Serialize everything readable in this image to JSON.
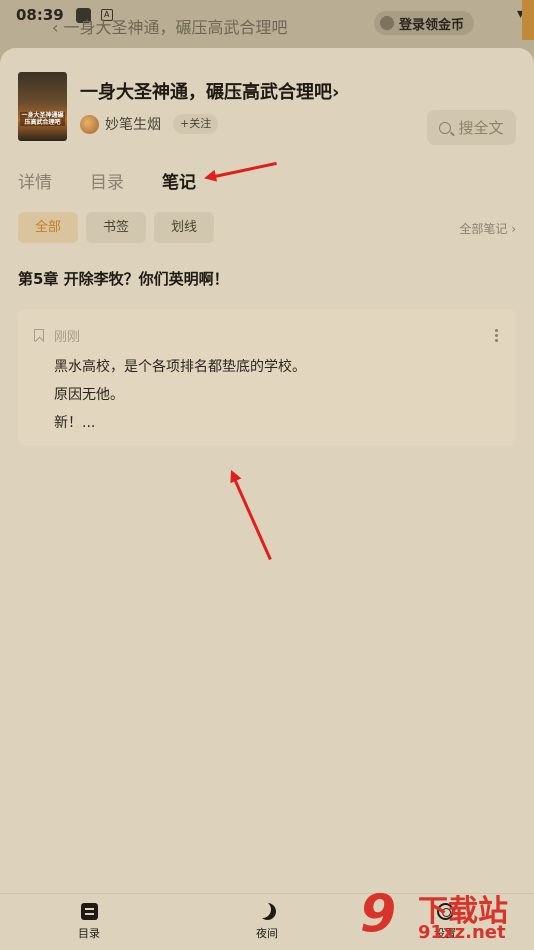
{
  "status_bar": {
    "time": "08:39"
  },
  "background": {
    "chapter_title": "一身大圣神通，碾压高武合理吧",
    "login_coin_label": "登录领金币"
  },
  "book": {
    "title": "一身大圣神通，碾压高武合理吧",
    "title_chevron": "›",
    "cover_text": "一身大圣神通碾压高武合理吧",
    "author": "妙笔生烟",
    "follow_label": "+关注",
    "search_label": "搜全文"
  },
  "tabs": [
    {
      "label": "详情"
    },
    {
      "label": "目录"
    },
    {
      "label": "笔记"
    }
  ],
  "active_tab": "笔记",
  "filters": [
    {
      "label": "全部"
    },
    {
      "label": "书签"
    },
    {
      "label": "划线"
    }
  ],
  "all_notes_label": "全部笔记 ›",
  "chapter": {
    "title": "第5章 开除李牧？你们英明啊！"
  },
  "note": {
    "time": "刚刚",
    "lines": [
      "黑水高校，是个各项排名都垫底的学校。",
      "原因无他。",
      "新！..."
    ]
  },
  "bottom_nav": [
    {
      "label": "目录",
      "icon": "toc-icon"
    },
    {
      "label": "夜间",
      "icon": "moon-icon"
    },
    {
      "label": "设置",
      "icon": "gear-icon"
    }
  ],
  "watermark": {
    "digit": "9",
    "text": "下载站",
    "url": "91xz.net"
  },
  "colors": {
    "sheet_bg": "#ddd3bd",
    "accent": "#c57b2a",
    "annotation_arrow": "#e01e1e"
  }
}
